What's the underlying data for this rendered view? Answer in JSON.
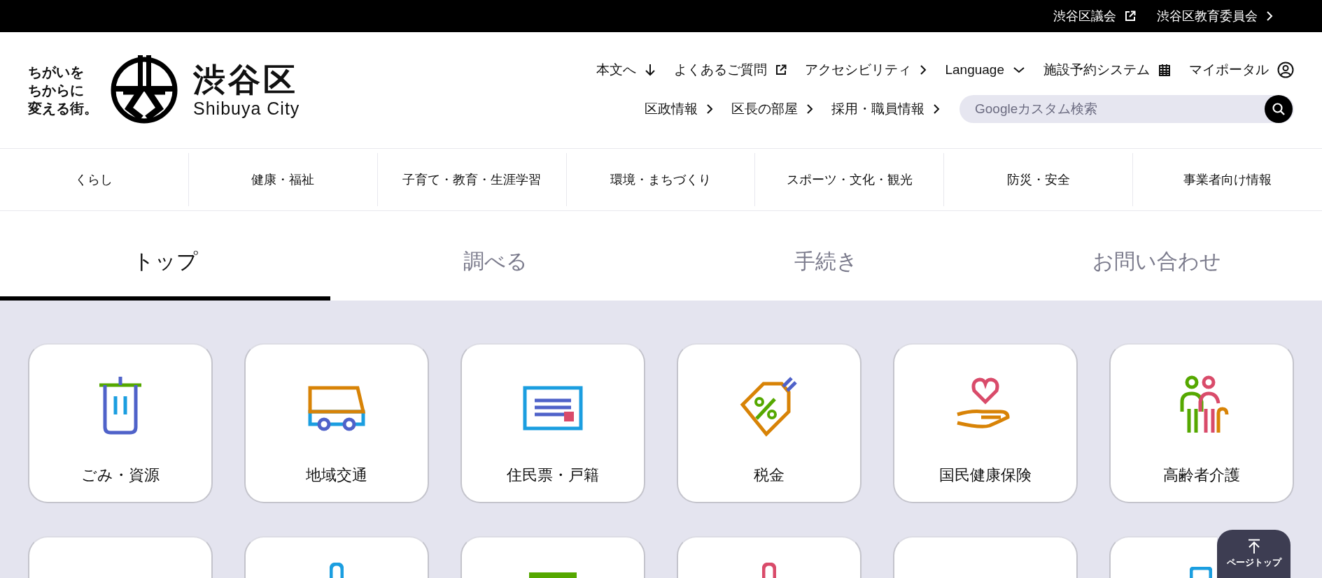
{
  "top_bar": {
    "links": [
      {
        "label": "渋谷区議会"
      },
      {
        "label": "渋谷区教育委員会"
      }
    ]
  },
  "header": {
    "tagline": [
      "ちがいを",
      "ちからに",
      "変える街。"
    ],
    "logo_title": "渋谷区",
    "logo_subtitle": "Shibuya City",
    "utility_links": [
      {
        "label": "本文へ"
      },
      {
        "label": "よくあるご質問"
      },
      {
        "label": "アクセシビリティ"
      },
      {
        "label": "Language"
      },
      {
        "label": "施設予約システム"
      },
      {
        "label": "マイポータル"
      }
    ],
    "sub_links": [
      {
        "label": "区政情報"
      },
      {
        "label": "区長の部屋"
      },
      {
        "label": "採用・職員情報"
      }
    ],
    "search": {
      "placeholder": "Googleカスタム検索"
    }
  },
  "category_nav": [
    "くらし",
    "健康・福祉",
    "子育て・教育・生涯学習",
    "環境・まちづくり",
    "スポーツ・文化・観光",
    "防災・安全",
    "事業者向け情報"
  ],
  "tabs": [
    {
      "label": "トップ",
      "selected": true
    },
    {
      "label": "調べる",
      "selected": false
    },
    {
      "label": "手続き",
      "selected": false
    },
    {
      "label": "お問い合わせ",
      "selected": false
    }
  ],
  "cards": [
    {
      "label": "ごみ・資源"
    },
    {
      "label": "地域交通"
    },
    {
      "label": "住民票・戸籍"
    },
    {
      "label": "税金"
    },
    {
      "label": "国民健康保険"
    },
    {
      "label": "高齢者介護"
    }
  ],
  "page_top_button": {
    "label": "ページトップ"
  }
}
